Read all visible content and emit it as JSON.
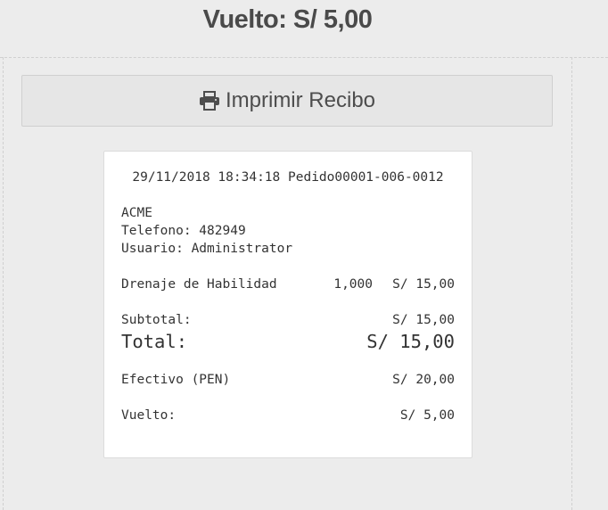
{
  "header": {
    "change_label": "Vuelto: S/ 5,00"
  },
  "actions": {
    "print_label": "Imprimir Recibo",
    "print_icon": "printer-icon"
  },
  "receipt": {
    "datetime": "29/11/2018 18:34:18",
    "order": "Pedido00001-006-0012",
    "company": "ACME",
    "phone": "Telefono: 482949",
    "user": "Usuario: Administrator",
    "items": [
      {
        "name": "Drenaje de Habilidad",
        "qty": "1,000",
        "amount": "S/ 15,00"
      }
    ],
    "subtotal_label": "Subtotal:",
    "subtotal_value": "S/ 15,00",
    "total_label": "Total:",
    "total_value": "S/ 15,00",
    "payment_label": "Efectivo (PEN)",
    "payment_value": "S/ 20,00",
    "change_label": "Vuelto:",
    "change_value": "S/ 5,00"
  }
}
